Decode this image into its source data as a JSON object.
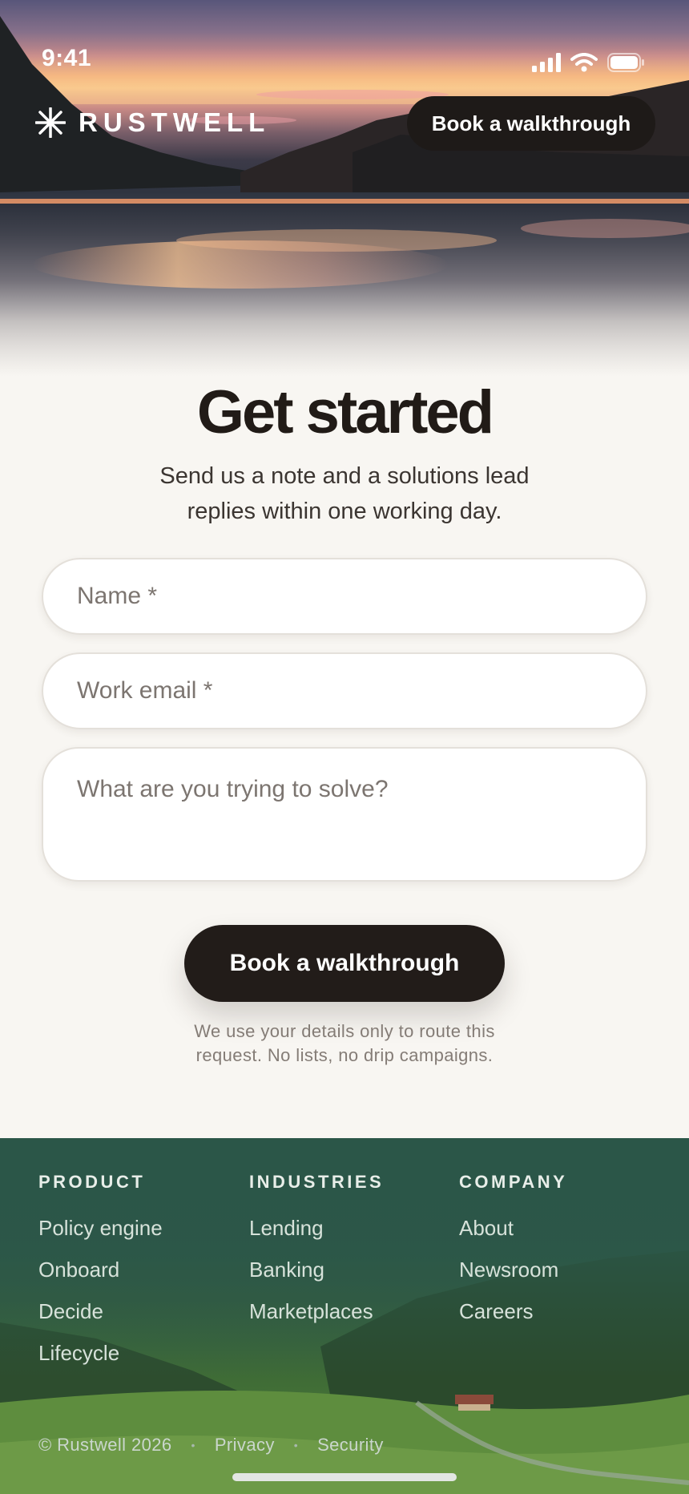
{
  "status_bar": {
    "time": "9:41",
    "icons": [
      "signal-icon",
      "wifi-icon",
      "battery-icon"
    ]
  },
  "header": {
    "brand_name": "RUSTWELL",
    "brand_icon": "asterisk-logo-icon",
    "cta_label": "Book a walkthrough"
  },
  "form": {
    "title": "Get started",
    "subtitle": "Send us a note and a solutions lead replies within one working day.",
    "name_placeholder": "Name *",
    "email_placeholder": "Work email *",
    "message_placeholder": "What are you trying to solve?",
    "submit_label": "Book a walkthrough",
    "note": "We use your details only to route this request. No lists, no drip campaigns."
  },
  "footer": {
    "columns": [
      {
        "heading": "PRODUCT",
        "links": [
          "Policy engine",
          "Onboard",
          "Decide",
          "Lifecycle"
        ]
      },
      {
        "heading": "INDUSTRIES",
        "links": [
          "Lending",
          "Banking",
          "Marketplaces"
        ]
      },
      {
        "heading": "COMPANY",
        "links": [
          "About",
          "Newsroom",
          "Careers"
        ]
      }
    ],
    "copyright": "© Rustwell 2026",
    "legal_links": [
      "Privacy",
      "Security"
    ]
  },
  "colors": {
    "primary_dark": "#221c19",
    "page_background": "#f8f6f2",
    "footer_green": "#2b5648"
  }
}
